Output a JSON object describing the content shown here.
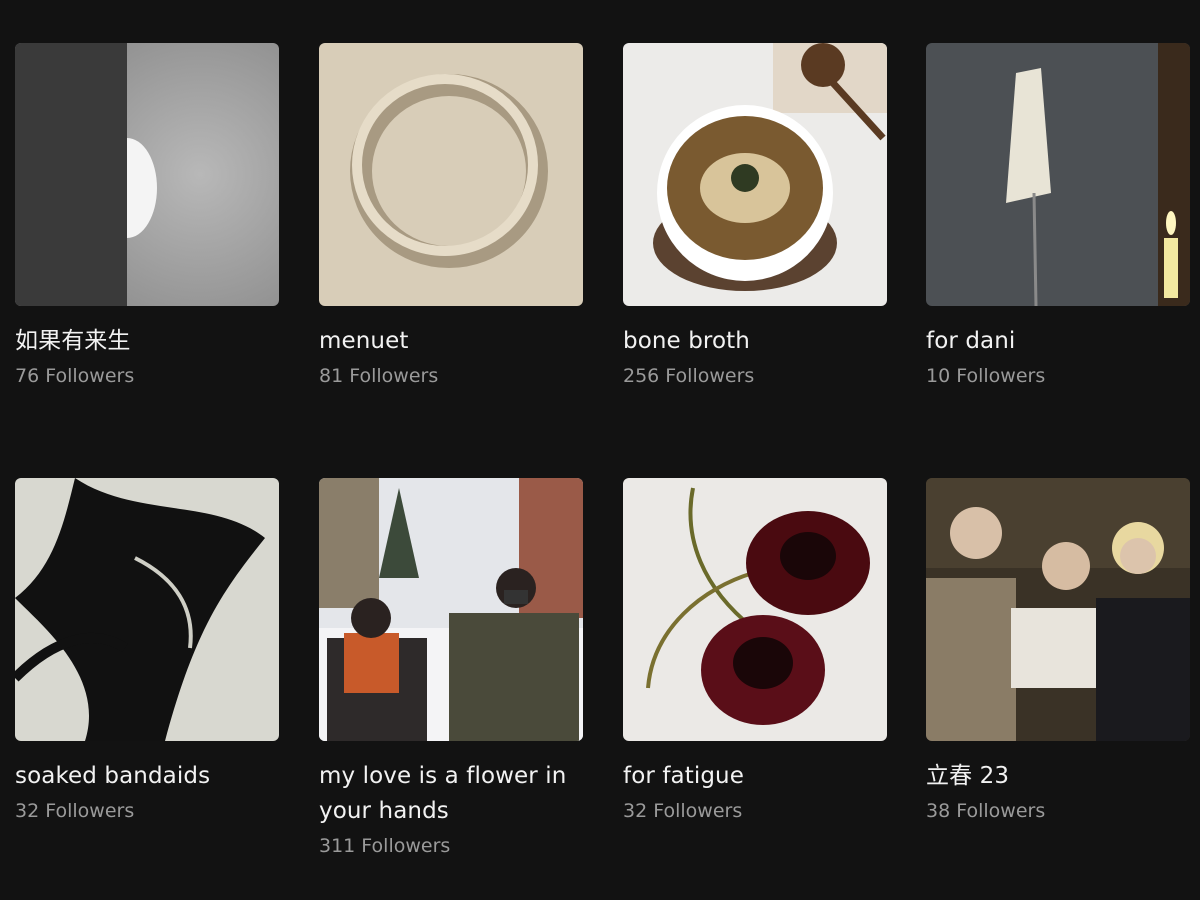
{
  "playlists": [
    {
      "title": "如果有来生",
      "followers": "76 Followers",
      "cover": "half-moon-cover"
    },
    {
      "title": "menuet",
      "followers": "81 Followers",
      "cover": "ring-cover"
    },
    {
      "title": "bone broth",
      "followers": "256 Followers",
      "cover": "noodle-bowl-cover"
    },
    {
      "title": "for dani",
      "followers": "10 Followers",
      "cover": "candle-cover"
    },
    {
      "title": "soaked bandaids",
      "followers": "32 Followers",
      "cover": "abstract-ink-cover"
    },
    {
      "title": "my love is a flower in your hands",
      "followers": "311 Followers",
      "cover": "snow-couple-cover"
    },
    {
      "title": "for fatigue",
      "followers": "32 Followers",
      "cover": "cherry-cover"
    },
    {
      "title": "立春 23",
      "followers": "38 Followers",
      "cover": "group-photo-cover"
    }
  ],
  "colors": {
    "background": "#121212",
    "title": "#f2f2f2",
    "followers": "#9a9a9a"
  }
}
